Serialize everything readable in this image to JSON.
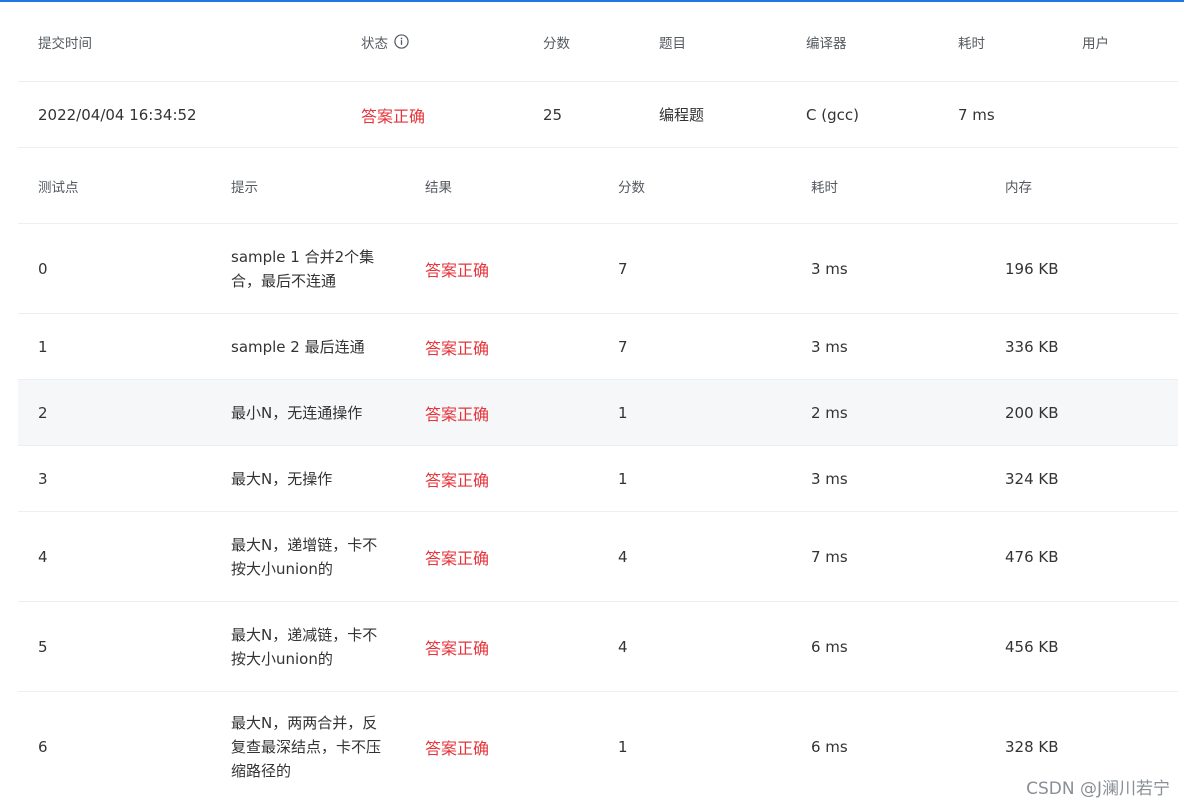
{
  "submission": {
    "headers": {
      "time": "提交时间",
      "status": "状态",
      "score": "分数",
      "problem": "题目",
      "compiler": "编译器",
      "duration": "耗时",
      "user": "用户"
    },
    "row": {
      "time": "2022/04/04 16:34:52",
      "status": "答案正确",
      "score": "25",
      "problem": "编程题",
      "compiler": "C (gcc)",
      "duration": "7 ms",
      "user": ""
    }
  },
  "tests": {
    "headers": {
      "id": "测试点",
      "hint": "提示",
      "result": "结果",
      "score": "分数",
      "duration": "耗时",
      "memory": "内存"
    },
    "rows": [
      {
        "id": "0",
        "hint": "sample 1 合并2个集合，最后不连通",
        "result": "答案正确",
        "score": "7",
        "duration": "3 ms",
        "memory": "196 KB"
      },
      {
        "id": "1",
        "hint": "sample 2 最后连通",
        "result": "答案正确",
        "score": "7",
        "duration": "3 ms",
        "memory": "336 KB"
      },
      {
        "id": "2",
        "hint": "最小N，无连通操作",
        "result": "答案正确",
        "score": "1",
        "duration": "2 ms",
        "memory": "200 KB"
      },
      {
        "id": "3",
        "hint": "最大N，无操作",
        "result": "答案正确",
        "score": "1",
        "duration": "3 ms",
        "memory": "324 KB"
      },
      {
        "id": "4",
        "hint": "最大N，递增链，卡不按大小union的",
        "result": "答案正确",
        "score": "4",
        "duration": "7 ms",
        "memory": "476 KB"
      },
      {
        "id": "5",
        "hint": "最大N，递减链，卡不按大小union的",
        "result": "答案正确",
        "score": "4",
        "duration": "6 ms",
        "memory": "456 KB"
      },
      {
        "id": "6",
        "hint": "最大N，两两合并，反复查最深结点，卡不压缩路径的",
        "result": "答案正确",
        "score": "1",
        "duration": "6 ms",
        "memory": "328 KB"
      }
    ]
  },
  "watermark": "CSDN @J澜川若宁",
  "colors": {
    "accent_bar": "#1f78e0",
    "accepted": "#e5343b",
    "hover_row": "#f6f7f9"
  }
}
